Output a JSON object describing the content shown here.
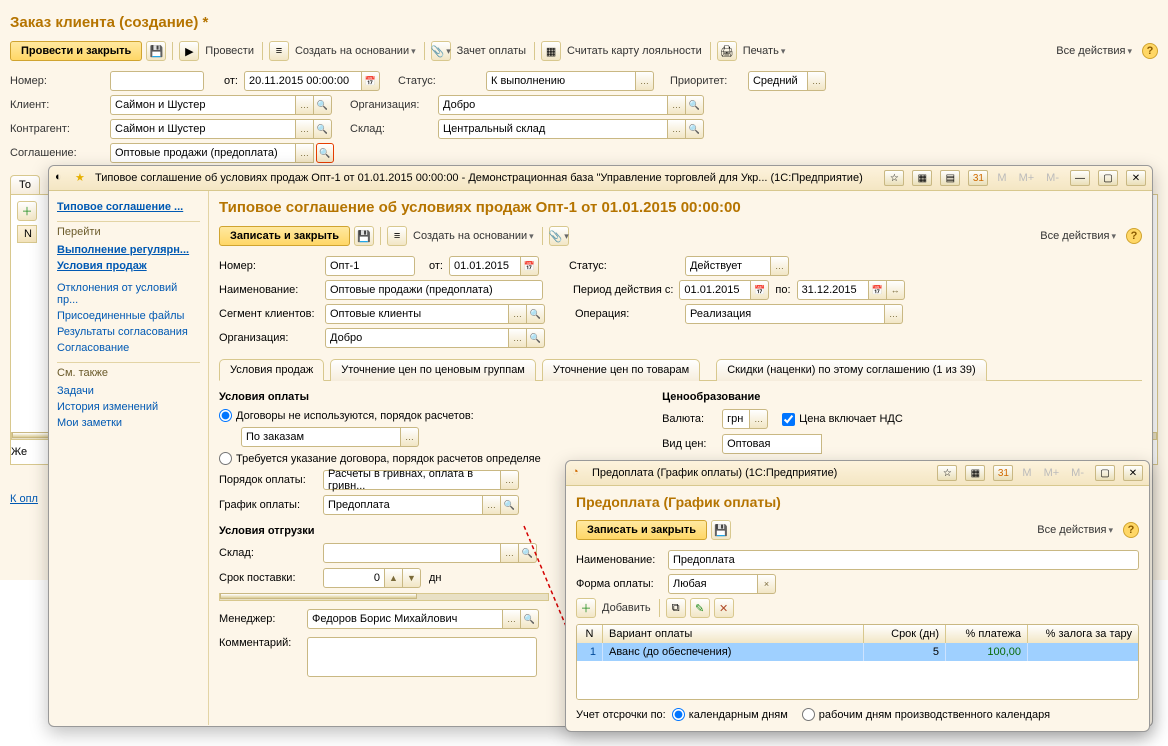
{
  "outer": {
    "title": "Заказ клиента (создание) *",
    "tb": {
      "post_close": "Провести и закрыть",
      "post": "Провести",
      "create_on": "Создать на основании",
      "offset": "Зачет оплаты",
      "read_card": "Считать карту лояльности",
      "print": "Печать",
      "all_actions": "Все действия"
    },
    "number_lbl": "Номер:",
    "from_lbl": "от:",
    "date": "20.11.2015 00:00:00",
    "status_lbl": "Статус:",
    "status": "К выполнению",
    "priority_lbl": "Приоритет:",
    "priority": "Средний",
    "client_lbl": "Клиент:",
    "client": "Саймон и Шустер",
    "org_lbl": "Организация:",
    "org": "Добро",
    "counter_lbl": "Контрагент:",
    "counter": "Саймон и Шустер",
    "warehouse_lbl": "Склад:",
    "warehouse": "Центральный склад",
    "agreement_lbl": "Соглашение:",
    "agreement": "Оптовые продажи (предоплата)",
    "tab_goods": "То",
    "grid_n": "N",
    "wish_label": "Же",
    "footer_link": "К опл"
  },
  "win1": {
    "title_bar": "Типовое соглашение об условиях продаж Опт-1 от 01.01.2015 00:00:00 - Демонстрационная база \"Управление торговлей для Укр...  (1С:Предприятие)",
    "side": {
      "h1": "Типовое соглашение ...",
      "go": "Перейти",
      "l1": "Выполнение регулярн...",
      "l2": "Условия продаж",
      "l3": "Отклонения от условий пр...",
      "l4": "Присоединенные файлы",
      "l5": "Результаты согласования",
      "l6": "Согласование",
      "see": "См. также",
      "l7": "Задачи",
      "l8": "История изменений",
      "l9": "Мои заметки"
    },
    "title": "Типовое соглашение об условиях продаж Опт-1 от 01.01.2015 00:00:00",
    "tb": {
      "save_close": "Записать и закрыть",
      "create_on": "Создать на основании",
      "all_actions": "Все действия"
    },
    "number_lbl": "Номер:",
    "number": "Опт-1",
    "from_lbl": "от:",
    "date": "01.01.2015",
    "status_lbl": "Статус:",
    "status": "Действует",
    "name_lbl": "Наименование:",
    "name": "Оптовые продажи (предоплата)",
    "period_lbl": "Период действия с:",
    "period_from": "01.01.2015",
    "period_to_lbl": "по:",
    "period_to": "31.12.2015",
    "segment_lbl": "Сегмент клиентов:",
    "segment": "Оптовые клиенты",
    "op_lbl": "Операция:",
    "op": "Реализация",
    "org_lbl": "Организация:",
    "org": "Добро",
    "tabs": {
      "t1": "Условия продаж",
      "t2": "Уточнение цен по ценовым группам",
      "t3": "Уточнение цен по товарам",
      "t4": "Скидки (наценки) по этому соглашению (1 из 39)"
    },
    "pay_h": "Условия оплаты",
    "r1": "Договоры не используются, порядок расчетов:",
    "r1v": "По заказам",
    "r2": "Требуется указание договора, порядок расчетов определяе",
    "pay_order_lbl": "Порядок оплаты:",
    "pay_order": "Расчеты в гривнах, оплата в гривн...",
    "pay_sched_lbl": "График оплаты:",
    "pay_sched": "Предоплата",
    "ship_h": "Условия отгрузки",
    "wh_lbl": "Склад:",
    "deliv_lbl": "Срок поставки:",
    "deliv_val": "0",
    "deliv_unit": "дн",
    "price_h": "Ценообразование",
    "cur_lbl": "Валюта:",
    "cur": "грн",
    "cb_vat": "Цена включает НДС",
    "pricetype_lbl": "Вид цен:",
    "pricetype": "Оптовая",
    "manager_lbl": "Менеджер:",
    "manager": "Федоров Борис Михайлович",
    "comment_lbl": "Комментарий:"
  },
  "win2": {
    "title_bar": "Предоплата (График оплаты)  (1С:Предприятие)",
    "title": "Предоплата (График оплаты)",
    "save_close": "Записать и закрыть",
    "all_actions": "Все действия",
    "name_lbl": "Наименование:",
    "name": "Предоплата",
    "form_lbl": "Форма оплаты:",
    "form": "Любая",
    "add": "Добавить",
    "th_n": "N",
    "th_variant": "Вариант оплаты",
    "th_days": "Срок (дн)",
    "th_pct": "% платежа",
    "th_dep": "% залога за тару",
    "row_n": "1",
    "row_variant": "Аванс (до обеспечения)",
    "row_days": "5",
    "row_pct": "100,00",
    "defer_lbl": "Учет отсрочки по:",
    "defer_r1": "календарным дням",
    "defer_r2": "рабочим дням производственного календаря"
  }
}
